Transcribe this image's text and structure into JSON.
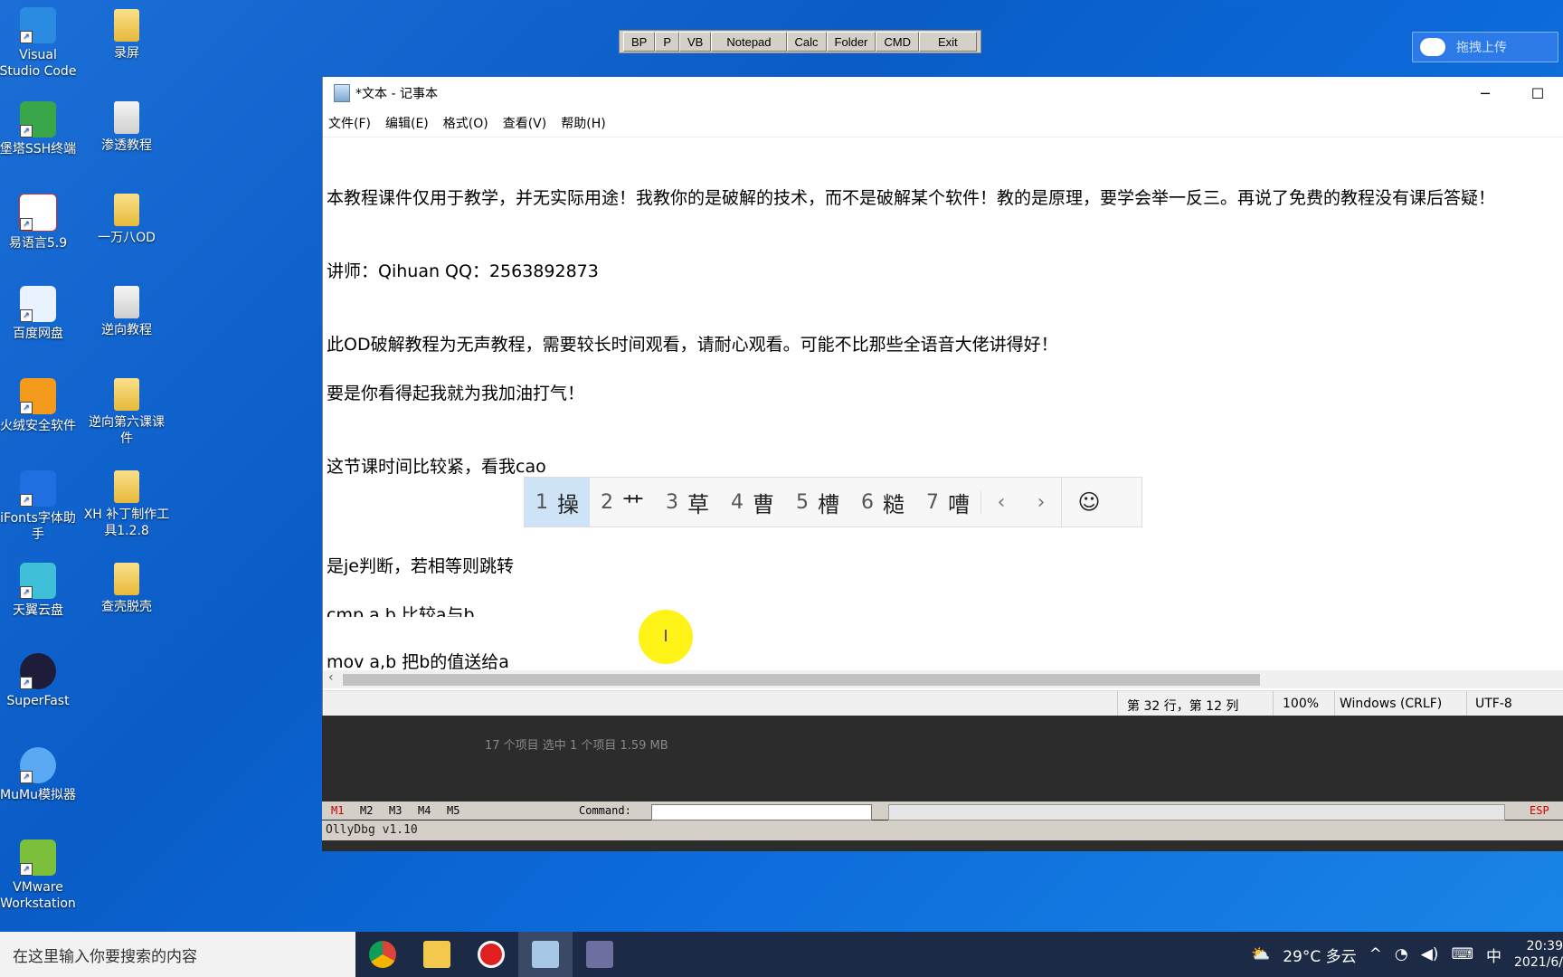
{
  "desktop": {
    "icons": [
      {
        "label": "Visual\nStudio Code"
      },
      {
        "label": "录屏"
      },
      {
        "label": "堡塔SSH终端"
      },
      {
        "label": "渗透教程"
      },
      {
        "label": "易语言5.9"
      },
      {
        "label": "一万八OD"
      },
      {
        "label": "百度网盘"
      },
      {
        "label": "逆向教程"
      },
      {
        "label": "火绒安全软件"
      },
      {
        "label": "逆向第六课课件"
      },
      {
        "label": "iFonts字体助手"
      },
      {
        "label": "XH 补丁制作工具1.2.8"
      },
      {
        "label": "天翼云盘"
      },
      {
        "label": "查壳脱壳"
      },
      {
        "label": "SuperFast"
      },
      {
        "label": "MuMu模拟器"
      },
      {
        "label": "VMware Workstation"
      }
    ]
  },
  "toolbar": {
    "buttons": [
      "BP",
      "P",
      "VB",
      "Notepad",
      "Calc",
      "Folder",
      "CMD",
      "Exit"
    ]
  },
  "upload": {
    "label": "拖拽上传"
  },
  "notepad": {
    "title": "*文本 - 记事本",
    "menu": [
      "文件(F)",
      "编辑(E)",
      "格式(O)",
      "查看(V)",
      "帮助(H)"
    ],
    "lines": [
      "本教程课件仅用于教学，并无实际用途！我教你的是破解的技术，而不是破解某个软件！教的是原理，要学会举一反三。再说了免费的教程没有课后答疑！",
      "讲师：Qihuan  QQ：2563892873",
      "此OD破解教程为无声教程，需要较长时间观看，请耐心观看。可能不比那些全语音大佬讲得好！",
      "要是你看得起我就为我加油打气！",
      "这节课时间比较紧，看我cao",
      "是je判断，若相等则跳转",
      "cmp a,b 比较a与b",
      "mov a,b 把b的值送给a"
    ],
    "status": {
      "position": "第 32 行，第 12 列",
      "zoom": "100%",
      "eol": "Windows (CRLF)",
      "encoding": "UTF-8"
    }
  },
  "ime": {
    "candidates": [
      {
        "n": "1",
        "c": "操"
      },
      {
        "n": "2",
        "c": "艹"
      },
      {
        "n": "3",
        "c": "草"
      },
      {
        "n": "4",
        "c": "曹"
      },
      {
        "n": "5",
        "c": "槽"
      },
      {
        "n": "6",
        "c": "糙"
      },
      {
        "n": "7",
        "c": "嘈"
      }
    ],
    "prev": "‹",
    "next": "›",
    "emoji": "☺"
  },
  "olly": {
    "ghost": "17 个项目    选中 1 个项目  1.59 MB",
    "markers": [
      "M1",
      "M2",
      "M3",
      "M4",
      "M5"
    ],
    "command_label": "Command:",
    "esp": "ESP",
    "title": "OllyDbg v1.10"
  },
  "taskbar": {
    "search_placeholder": "在这里输入你要搜索的内容",
    "weather": "29°C  多云",
    "ime_indicator": "中",
    "time": "20:39",
    "date": "2021/6/"
  },
  "colors": {
    "desktop_bg": "#0a5cc7",
    "ime_selected": "#cfe3f7",
    "cursor_highlight": "#fff200",
    "taskbar": "#1c2a45"
  }
}
